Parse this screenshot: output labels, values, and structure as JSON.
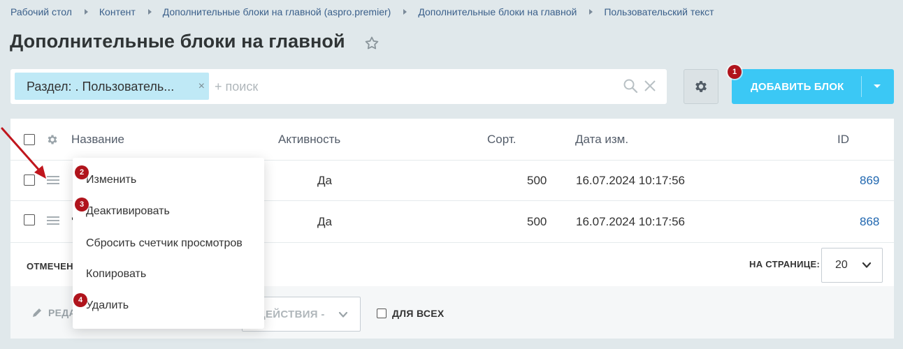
{
  "breadcrumbs": [
    {
      "label": "Рабочий стол"
    },
    {
      "label": "Контент"
    },
    {
      "label": "Дополнительные блоки на главной (aspro.premier)"
    },
    {
      "label": "Дополнительные блоки на главной"
    },
    {
      "label": "Пользовательский текст"
    }
  ],
  "page": {
    "title": "Дополнительные блоки на главной"
  },
  "search": {
    "filter_tag": "Раздел: . Пользователь...",
    "filter_remove": "×",
    "placeholder": "+ поиск"
  },
  "toolbar": {
    "add_label": "ДОБАВИТЬ БЛОК"
  },
  "grid": {
    "columns": {
      "name": "Название",
      "active": "Активность",
      "sort": "Сорт.",
      "date": "Дата изм.",
      "id": "ID"
    },
    "rows": [
      {
        "active": "Да",
        "sort": "500",
        "date": "16.07.2024 10:17:56",
        "id": "869"
      },
      {
        "active": "Да",
        "sort": "500",
        "date": "16.07.2024 10:17:56",
        "id": "868"
      }
    ],
    "row2_name_partial": "'"
  },
  "footer": {
    "marked": "ОТМЕЧЕН",
    "per_page_label": "НА СТРАНИЦЕ:",
    "per_page_value": "20"
  },
  "actions": {
    "edit": "РЕДА",
    "select": "ДЕЙСТВИЯ -",
    "for_all": "ДЛЯ ВСЕХ"
  },
  "context_menu": {
    "items": [
      {
        "label": "Изменить"
      },
      {
        "label": "Деактивировать"
      },
      {
        "label": "Сбросить счетчик просмотров"
      },
      {
        "label": "Копировать"
      },
      {
        "label": "Удалить"
      }
    ]
  },
  "badges": [
    "1",
    "2",
    "3",
    "4"
  ],
  "colors": {
    "accent": "#3bc8f5",
    "badge": "#b0141c",
    "link": "#2067b0",
    "background": "#e0e8eb",
    "filter_tag": "#bfe9f6"
  }
}
